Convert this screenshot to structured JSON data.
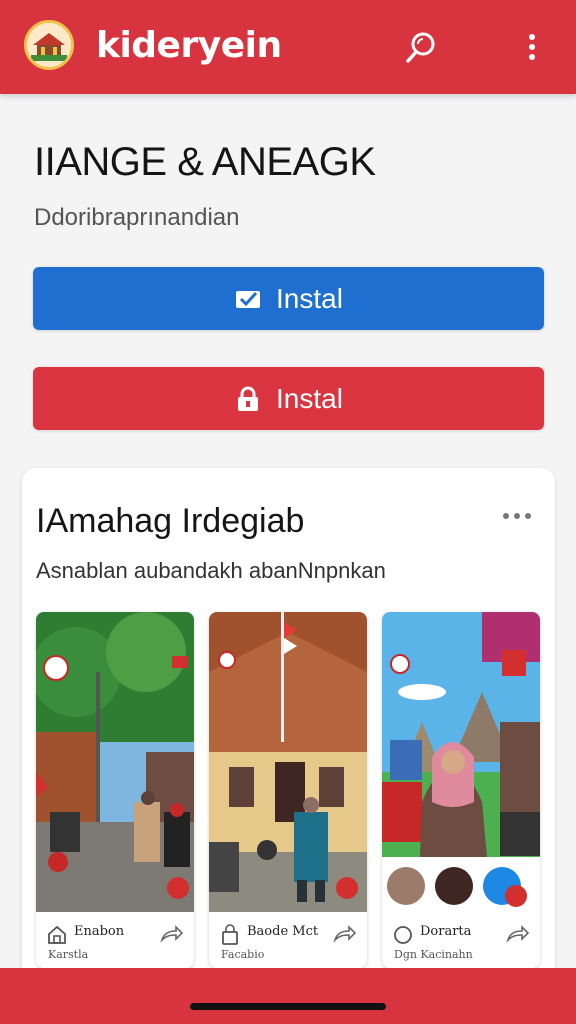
{
  "header": {
    "app_name": "kideryein",
    "logo_icon": "museum-logo-icon",
    "search_icon": "search-icon",
    "more_icon": "more-vertical-icon",
    "bg_color": "#d8343f"
  },
  "hero": {
    "title": "IIANGE & ANEAGK",
    "subtitle": "Ddoribraprınandian"
  },
  "buttons": {
    "primary": {
      "label": "Instal",
      "icon": "message-check-icon",
      "color": "#1f6fd0"
    },
    "secondary": {
      "label": "Instal",
      "icon": "lock-icon",
      "color": "#d9343f"
    }
  },
  "card": {
    "title": "IAmahag Irdegiab",
    "subtitle": "Asnablan aubandakh abanNnpnkan",
    "more_icon": "more-horizontal-icon",
    "tiles": [
      {
        "name": "Enabon",
        "sub": "Karstla",
        "icon": "home-icon",
        "share_icon": "share-icon"
      },
      {
        "name": "Baode Mct",
        "sub": "Facabio",
        "icon": "bag-icon",
        "share_icon": "share-icon"
      },
      {
        "name": "Dorarta",
        "sub": "Dgn Kacinahn",
        "icon": "circle-icon",
        "share_icon": "share-icon"
      }
    ]
  }
}
